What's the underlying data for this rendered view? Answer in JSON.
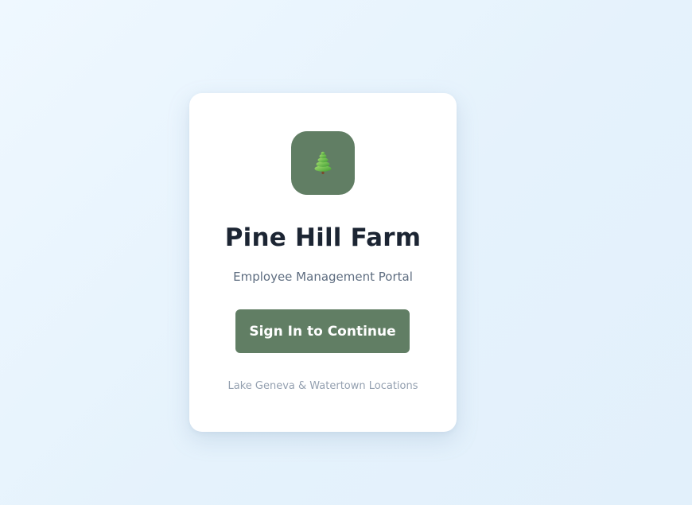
{
  "brand": {
    "logo_icon": "pine-tree-icon",
    "name": "Pine Hill Farm",
    "tagline": "Employee Management Portal",
    "color": "#617e64"
  },
  "actions": {
    "sign_in_label": "Sign In to Continue"
  },
  "footer": {
    "locations": "Lake Geneva & Watertown Locations"
  }
}
